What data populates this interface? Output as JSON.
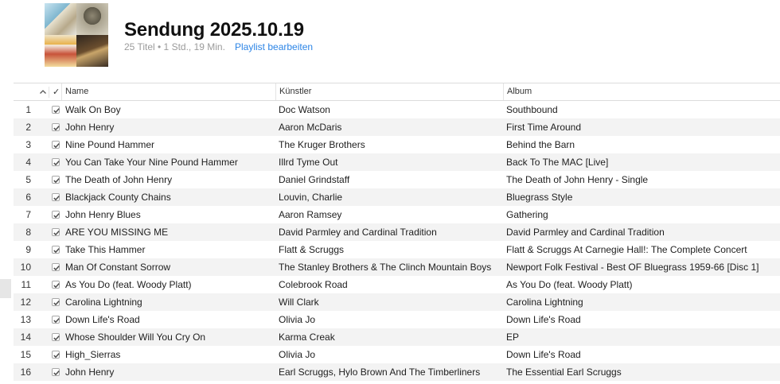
{
  "playlist": {
    "title": "Sendung 2025.10.19",
    "summary": "25 Titel • 1 Std., 19 Min.",
    "edit_label": "Playlist bearbeiten"
  },
  "columns": {
    "sort_icon": "chevron-up-icon",
    "check": "✓",
    "name": "Name",
    "artist": "Künstler",
    "album": "Album"
  },
  "tracks": [
    {
      "num": "1",
      "checked": true,
      "name": "Walk On Boy",
      "artist": "Doc Watson",
      "album": "Southbound"
    },
    {
      "num": "2",
      "checked": true,
      "name": "John Henry",
      "artist": "Aaron McDaris",
      "album": "First Time Around"
    },
    {
      "num": "3",
      "checked": true,
      "name": "Nine Pound Hammer",
      "artist": "The Kruger Brothers",
      "album": "Behind the Barn"
    },
    {
      "num": "4",
      "checked": true,
      "name": "You Can Take Your Nine Pound Hammer",
      "artist": "Illrd Tyme Out",
      "album": "Back To The MAC [Live]"
    },
    {
      "num": "5",
      "checked": true,
      "name": "The Death of John Henry",
      "artist": "Daniel Grindstaff",
      "album": "The Death of John Henry - Single"
    },
    {
      "num": "6",
      "checked": true,
      "name": "Blackjack County Chains",
      "artist": "Louvin, Charlie",
      "album": "Bluegrass Style"
    },
    {
      "num": "7",
      "checked": true,
      "name": "John Henry Blues",
      "artist": "Aaron Ramsey",
      "album": "Gathering"
    },
    {
      "num": "8",
      "checked": true,
      "name": "ARE YOU MISSING ME",
      "artist": "David Parmley and Cardinal Tradition",
      "album": "David Parmley and Cardinal Tradition"
    },
    {
      "num": "9",
      "checked": true,
      "name": "Take This Hammer",
      "artist": "Flatt & Scruggs",
      "album": "Flatt & Scruggs At Carnegie Hall!: The Complete Concert"
    },
    {
      "num": "10",
      "checked": true,
      "name": "Man Of Constant Sorrow",
      "artist": "The Stanley Brothers & The Clinch Mountain Boys",
      "album": "Newport Folk Festival - Best OF Bluegrass 1959-66 [Disc 1]"
    },
    {
      "num": "11",
      "checked": true,
      "name": "As You Do (feat. Woody Platt)",
      "artist": "Colebrook Road",
      "album": "As You Do (feat. Woody Platt)"
    },
    {
      "num": "12",
      "checked": true,
      "name": "Carolina Lightning",
      "artist": "Will Clark",
      "album": "Carolina Lightning"
    },
    {
      "num": "13",
      "checked": true,
      "name": "Down Life's Road",
      "artist": "Olivia Jo",
      "album": "Down Life's Road"
    },
    {
      "num": "14",
      "checked": true,
      "name": "Whose Shoulder Will You Cry On",
      "artist": "Karma Creak",
      "album": "EP"
    },
    {
      "num": "15",
      "checked": true,
      "name": "High_Sierras",
      "artist": "Olivia Jo",
      "album": "Down Life's Road"
    },
    {
      "num": "16",
      "checked": true,
      "name": "John Henry",
      "artist": "Earl Scruggs, Hylo Brown And The Timberliners",
      "album": "The Essential Earl Scruggs"
    }
  ],
  "colors": {
    "link": "#2d85e6",
    "row_alt": "#f3f3f3",
    "subtitle": "#9b9b9b"
  }
}
